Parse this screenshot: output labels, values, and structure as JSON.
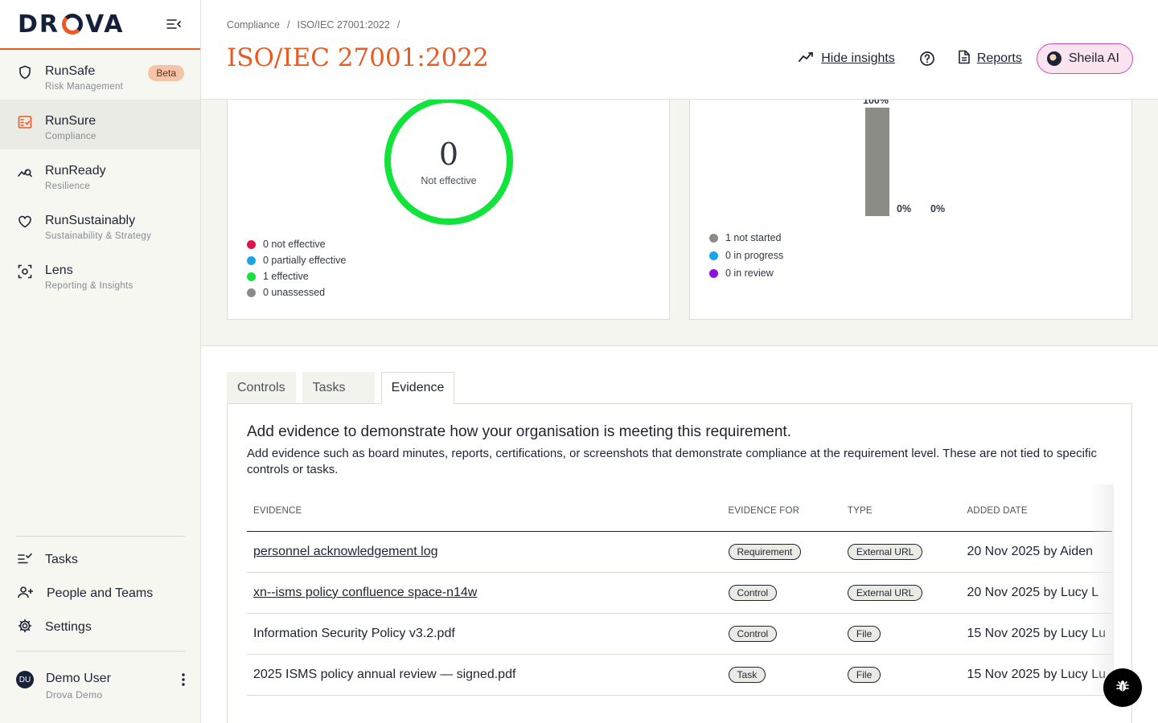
{
  "brand": {
    "logo_text": "DROVA"
  },
  "sidebar": {
    "items": [
      {
        "title": "RunSafe",
        "sub": "Risk Management",
        "badge": "Beta",
        "icon": "shield-icon"
      },
      {
        "title": "RunSure",
        "sub": "Compliance",
        "icon": "checklist-icon"
      },
      {
        "title": "RunReady",
        "sub": "Resilience",
        "icon": "chart-search-icon"
      },
      {
        "title": "RunSustainably",
        "sub": "Sustainability & Strategy",
        "icon": "heart-icon"
      },
      {
        "title": "Lens",
        "sub": "Reporting & Insights",
        "icon": "scan-icon"
      }
    ],
    "bottom": [
      {
        "label": "Tasks",
        "icon": "tasks-icon"
      },
      {
        "label": "People and Teams",
        "icon": "people-icon"
      },
      {
        "label": "Settings",
        "icon": "gear-icon"
      }
    ],
    "user": {
      "initials": "DU",
      "name": "Demo User",
      "org": "Drova Demo"
    }
  },
  "header": {
    "breadcrumb": [
      "Compliance",
      "/",
      "ISO/IEC 27001:2022",
      "/"
    ],
    "title": "ISO/IEC 27001:2022",
    "hide_insights": "Hide insights",
    "reports": "Reports",
    "sheila": "Sheila AI"
  },
  "effectiveness": {
    "value": "0",
    "label": "Not effective",
    "ring_color": "#12e33b",
    "legend": [
      {
        "text": "0 not effective",
        "color": "#e0134a"
      },
      {
        "text": "0 partially effective",
        "color": "#1aa4e8"
      },
      {
        "text": "1 effective",
        "color": "#12e33b"
      },
      {
        "text": "0 unassessed",
        "color": "#8c8c87"
      }
    ]
  },
  "tasks_status": {
    "bars": [
      {
        "label": "100%",
        "value": 100,
        "color": "#8c8c87"
      },
      {
        "label": "0%",
        "value": 0,
        "color": "#1aa4e8"
      },
      {
        "label": "0%",
        "value": 0,
        "color": "#8a12e0"
      }
    ],
    "legend": [
      {
        "text": "1 not started",
        "color": "#8c8c87"
      },
      {
        "text": "0 in progress",
        "color": "#1aa4e8"
      },
      {
        "text": "0 in review",
        "color": "#8a12e0"
      }
    ]
  },
  "tabs": [
    "Controls",
    "Tasks",
    "Evidence"
  ],
  "evidence": {
    "heading": "Add evidence to demonstrate how your organisation is meeting this requirement.",
    "description": "Add evidence such as board minutes, reports, certifications, or screenshots that demonstrate compliance at the requirement level. These are not tied to specific controls or tasks.",
    "columns": [
      "EVIDENCE",
      "EVIDENCE FOR",
      "TYPE",
      "ADDED DATE"
    ],
    "rows": [
      {
        "name": "personnel acknowledgement log",
        "link": true,
        "for": "Requirement",
        "type": "External URL",
        "date": "20 Nov 2025 by Aiden"
      },
      {
        "name": "xn--isms policy confluence space-n14w",
        "link": true,
        "for": "Control",
        "type": "External URL",
        "date": "20 Nov 2025 by Lucy L"
      },
      {
        "name": "Information Security Policy v3.2.pdf",
        "link": false,
        "for": "Control",
        "type": "File",
        "date": "15 Nov 2025 by Lucy Lu"
      },
      {
        "name": "2025 ISMS policy annual review — signed.pdf",
        "link": false,
        "for": "Task",
        "type": "File",
        "date": "15 Nov 2025 by Lucy Lu"
      }
    ]
  },
  "colors": {
    "accent": "#ec5a24",
    "navy": "#15213b"
  }
}
